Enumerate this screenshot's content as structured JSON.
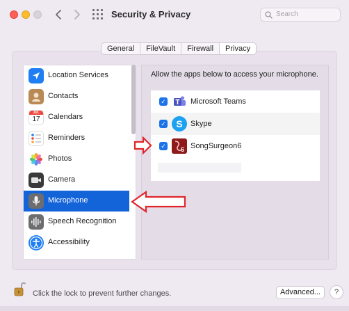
{
  "window": {
    "title": "Security & Privacy",
    "search_placeholder": "Search",
    "nav_back_icon": "chevron-left-icon",
    "nav_forward_icon": "chevron-right-icon"
  },
  "tabs": [
    {
      "label": "General",
      "active": false
    },
    {
      "label": "FileVault",
      "active": false
    },
    {
      "label": "Firewall",
      "active": false
    },
    {
      "label": "Privacy",
      "active": true
    }
  ],
  "sidebar": {
    "items": [
      {
        "label": "Location Services",
        "icon": "location-arrow-icon"
      },
      {
        "label": "Contacts",
        "icon": "contacts-book-icon"
      },
      {
        "label": "Calendars",
        "icon": "calendar-icon",
        "icon_month": "JUL",
        "icon_day": "17"
      },
      {
        "label": "Reminders",
        "icon": "reminders-list-icon"
      },
      {
        "label": "Photos",
        "icon": "photos-flower-icon"
      },
      {
        "label": "Camera",
        "icon": "camera-icon"
      },
      {
        "label": "Microphone",
        "icon": "microphone-icon",
        "selected": true
      },
      {
        "label": "Speech Recognition",
        "icon": "waveform-icon"
      },
      {
        "label": "Accessibility",
        "icon": "accessibility-figure-icon"
      }
    ]
  },
  "microphone": {
    "description": "Allow the apps below to access your microphone.",
    "apps": [
      {
        "label": "Microsoft Teams",
        "checked": true,
        "icon": "microsoft-teams-icon"
      },
      {
        "label": "Skype",
        "checked": true,
        "icon": "skype-icon"
      },
      {
        "label": "SongSurgeon6",
        "checked": true,
        "icon": "songsurgeon-icon"
      }
    ]
  },
  "footer": {
    "lock_text": "Click the lock to prevent further changes.",
    "advanced_label": "Advanced...",
    "help_label": "?"
  },
  "colors": {
    "selection": "#1464d9",
    "checkbox": "#1a73e8",
    "annotation_arrow": "#e0262b"
  }
}
